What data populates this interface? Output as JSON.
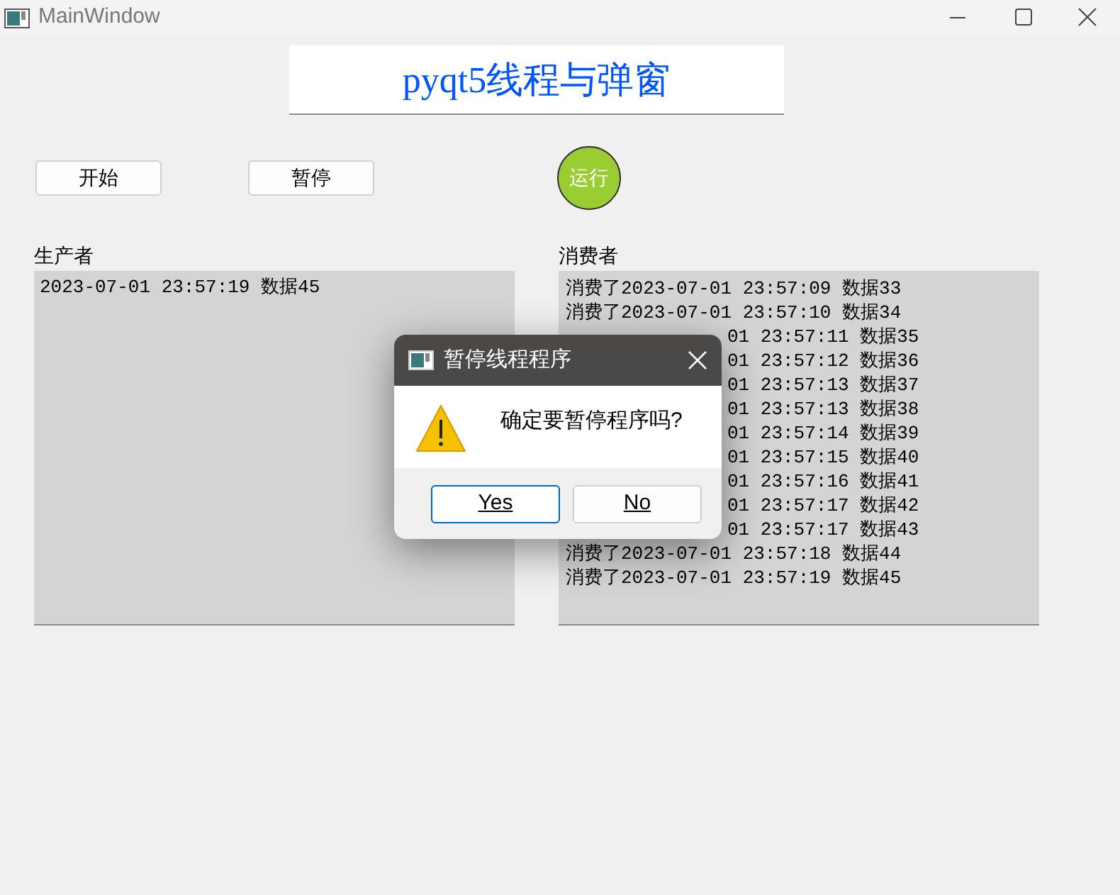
{
  "window": {
    "title": "MainWindow"
  },
  "heading": "pyqt5线程与弹窗",
  "buttons": [
    {
      "label": "开始"
    },
    {
      "label": "暂停"
    }
  ],
  "indicator": {
    "label": "运行",
    "color": "#9acd32"
  },
  "producer": {
    "label": "生产者",
    "lines": [
      "2023-07-01 23:57:19 数据45"
    ]
  },
  "consumer": {
    "label": "消费者",
    "lines": [
      {
        "text": "消费了2023-07-01 23:57:09 数据33",
        "covered": false
      },
      {
        "text": "消费了2023-07-01 23:57:10 数据34",
        "covered": false
      },
      {
        "text": "01 23:57:11 数据35",
        "covered": true
      },
      {
        "text": "01 23:57:12 数据36",
        "covered": true
      },
      {
        "text": "01 23:57:13 数据37",
        "covered": true
      },
      {
        "text": "01 23:57:13 数据38",
        "covered": true
      },
      {
        "text": "01 23:57:14 数据39",
        "covered": true
      },
      {
        "text": "01 23:57:15 数据40",
        "covered": true
      },
      {
        "text": "01 23:57:16 数据41",
        "covered": true
      },
      {
        "text": "01 23:57:17 数据42",
        "covered": true
      },
      {
        "text": "01 23:57:17 数据43",
        "covered": true
      },
      {
        "text": "消费了2023-07-01 23:57:18 数据44",
        "covered": false
      },
      {
        "text": "消费了2023-07-01 23:57:19 数据45",
        "covered": false
      }
    ]
  },
  "dialog": {
    "title": "暂停线程程序",
    "message": "确定要暂停程序吗?",
    "buttons": [
      {
        "label": "Yes",
        "selected": true
      },
      {
        "label": "No",
        "selected": false
      }
    ]
  }
}
